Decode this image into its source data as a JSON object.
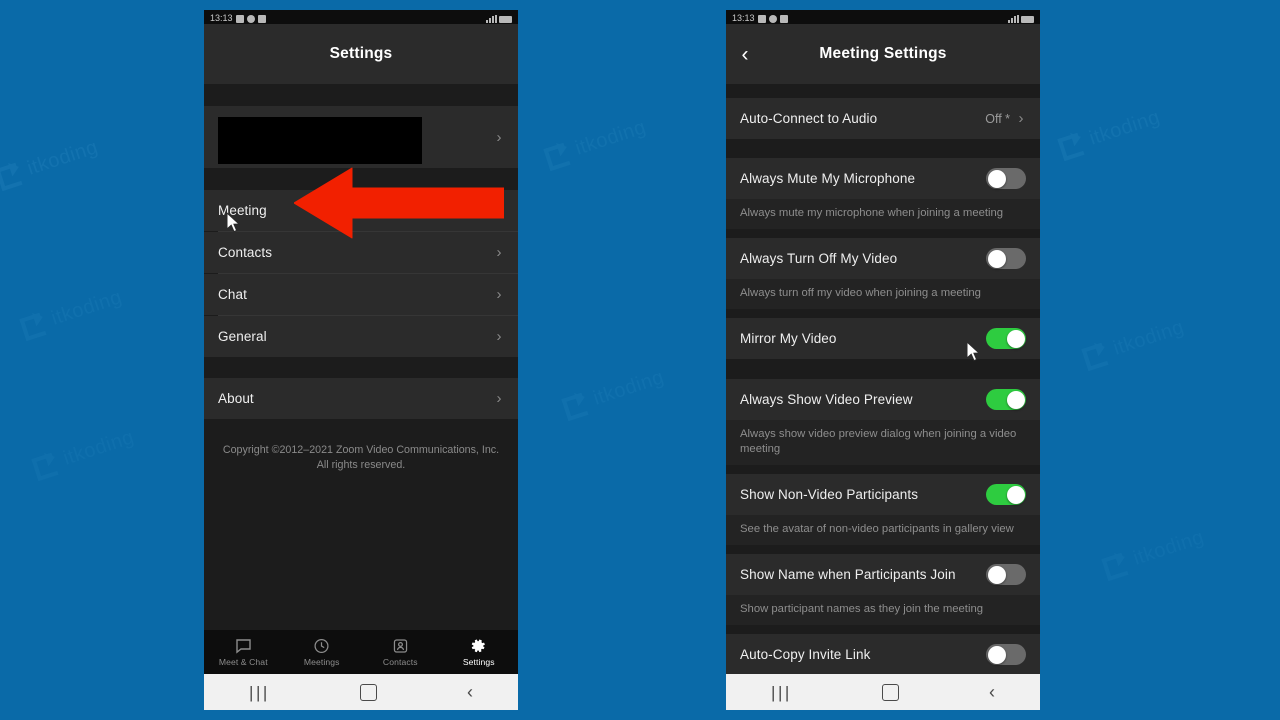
{
  "page": {
    "background_color": "#0a6aa8",
    "watermark_text": "itkoding"
  },
  "annotations": {
    "arrow": {
      "name": "red-arrow",
      "color": "#f22000",
      "direction": "left",
      "points_at": "Meeting"
    },
    "cursor_left": "mouse-cursor",
    "cursor_right": "mouse-cursor"
  },
  "left_phone": {
    "statusbar": {
      "time": "13:13"
    },
    "appbar": {
      "title": "Settings"
    },
    "profile": {
      "redacted": "",
      "chevron": "›"
    },
    "menu_items": [
      {
        "label": "Meeting",
        "chevron": "›"
      },
      {
        "label": "Contacts",
        "chevron": "›"
      },
      {
        "label": "Chat",
        "chevron": "›"
      },
      {
        "label": "General",
        "chevron": "›"
      }
    ],
    "about_item": {
      "label": "About",
      "chevron": "›"
    },
    "copyright_line1": "Copyright ©2012–2021 Zoom Video Communications, Inc.",
    "copyright_line2": "All rights reserved.",
    "tabs": [
      {
        "label": "Meet & Chat",
        "icon": "chat-bubble-icon",
        "active": false
      },
      {
        "label": "Meetings",
        "icon": "clock-icon",
        "active": false
      },
      {
        "label": "Contacts",
        "icon": "contact-card-icon",
        "active": false
      },
      {
        "label": "Settings",
        "icon": "gear-icon",
        "active": true
      }
    ],
    "navbar": {
      "recent": "|||",
      "home": "",
      "back": "‹"
    }
  },
  "right_phone": {
    "statusbar": {
      "time": "13:13"
    },
    "appbar": {
      "title": "Meeting Settings",
      "back": "‹"
    },
    "rows": [
      {
        "type": "value",
        "label": "Auto-Connect to Audio",
        "value": "Off *",
        "chevron": "›"
      },
      {
        "type": "toggle",
        "label": "Always Mute My Microphone",
        "on": false,
        "desc": "Always mute my microphone when joining a meeting"
      },
      {
        "type": "toggle",
        "label": "Always Turn Off My Video",
        "on": false,
        "desc": "Always turn off my video when joining a meeting"
      },
      {
        "type": "toggle",
        "label": "Mirror My Video",
        "on": true,
        "desc": ""
      },
      {
        "type": "toggle",
        "label": "Always Show Video Preview",
        "on": true,
        "desc": "Always show video preview dialog when joining a video meeting"
      },
      {
        "type": "toggle",
        "label": "Show Non-Video Participants",
        "on": true,
        "desc": "See the avatar of non-video participants in gallery view"
      },
      {
        "type": "toggle",
        "label": "Show Name when Participants Join",
        "on": false,
        "desc": "Show participant names as they join the meeting"
      },
      {
        "type": "toggle",
        "label": "Auto-Copy Invite Link",
        "on": false,
        "desc": ""
      }
    ],
    "navbar": {
      "recent": "|||",
      "home": "",
      "back": "‹"
    }
  }
}
